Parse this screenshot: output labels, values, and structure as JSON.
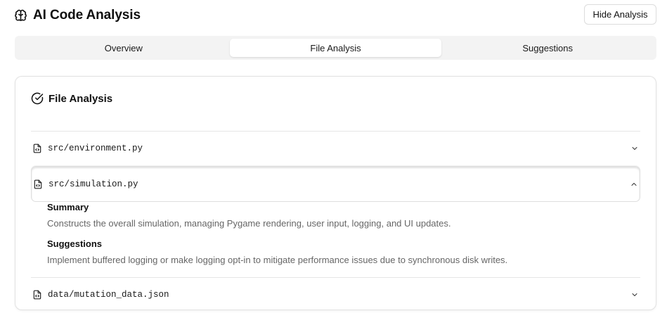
{
  "header": {
    "title": "AI Code Analysis",
    "hide_button": "Hide Analysis",
    "title_icon": "brain-icon"
  },
  "tabs": [
    {
      "label": "Overview",
      "active": false
    },
    {
      "label": "File Analysis",
      "active": true
    },
    {
      "label": "Suggestions",
      "active": false
    }
  ],
  "card": {
    "title": "File Analysis",
    "title_icon": "check-circle-icon"
  },
  "files": [
    {
      "name": "src/environment.py",
      "expanded": false
    },
    {
      "name": "src/simulation.py",
      "expanded": true,
      "summary_label": "Summary",
      "summary": "Constructs the overall simulation, managing Pygame rendering, user input, logging, and UI updates.",
      "suggestions_label": "Suggestions",
      "suggestions": "Implement buffered logging or make logging opt-in to mitigate performance issues due to synchronous disk writes."
    },
    {
      "name": "data/mutation_data.json",
      "expanded": false
    }
  ],
  "colors": {
    "border": "#e2e2e2",
    "tab_bg": "#f3f3f3",
    "muted_text": "#666666"
  }
}
